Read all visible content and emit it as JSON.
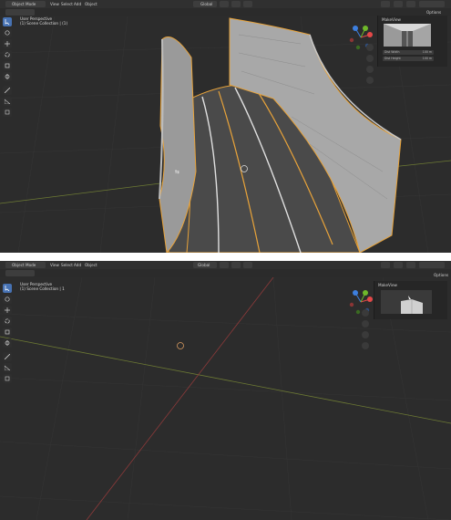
{
  "header": {
    "mode_label": "Object Mode",
    "menus": [
      "View",
      "Select",
      "Add",
      "Object"
    ],
    "orientation_label": "Global",
    "options_label": "Options"
  },
  "overlay": {
    "view_name": "User Perspective",
    "collection_label": "(1) Scene Collection | (1)",
    "collection_label_bottom": "(1) Scene Collection | 1"
  },
  "npanel": {
    "title": "MakeView",
    "field_1_label": "Dist Width",
    "field_1_value": "100 m",
    "field_2_label": "Dist Height",
    "field_2_value": "100 m"
  },
  "colors": {
    "viewport_bg": "#2c2c2c",
    "grid_line": "#363636",
    "x_axis": "#8c3a3a",
    "y_axis": "#7a8a3a",
    "selection_outline": "#e8a33a",
    "active_tool": "#4772b3",
    "gizmo_x": "#e44848",
    "gizmo_y": "#6fb82a",
    "gizmo_z": "#3d7fdf"
  },
  "icons": {
    "tools": [
      "select-box-icon",
      "cursor-icon",
      "move-icon",
      "rotate-icon",
      "scale-icon",
      "transform-icon",
      "annotate-icon",
      "measure-icon",
      "add-cube-icon"
    ],
    "nav": [
      "zoom-icon",
      "hand-pan-icon",
      "camera-icon",
      "grid-icon"
    ]
  }
}
